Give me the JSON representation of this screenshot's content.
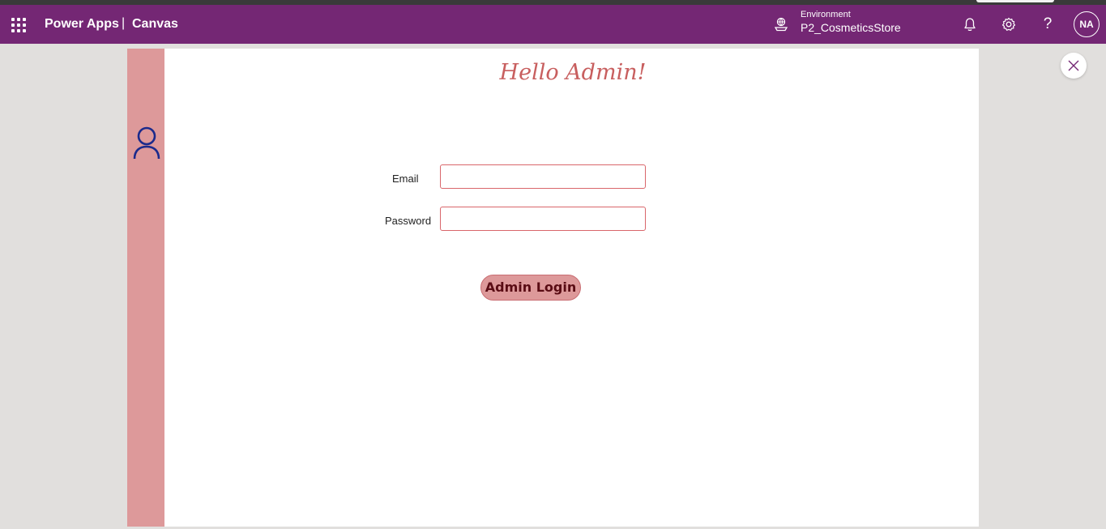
{
  "header": {
    "app_name": "Power Apps",
    "separator": "|",
    "app_type": "Canvas",
    "environment_label": "Environment",
    "environment_value": "P2_CosmeticsStore",
    "help_glyph": "?",
    "avatar_initials": "NA",
    "background_color": "#742774"
  },
  "icons": {
    "waffle": "waffle-icon",
    "environment": "environment-icon",
    "notifications": "bell-icon",
    "settings": "gear-icon",
    "help": "help-icon",
    "close": "close-icon",
    "user": "user-icon"
  },
  "canvas": {
    "greeting": "Hello Admin!",
    "side_bar_color": "#dd999a",
    "form": {
      "email_label": "Email",
      "email_value": "",
      "password_label": "Password",
      "password_value": "",
      "login_button_label": "Admin Login"
    }
  }
}
